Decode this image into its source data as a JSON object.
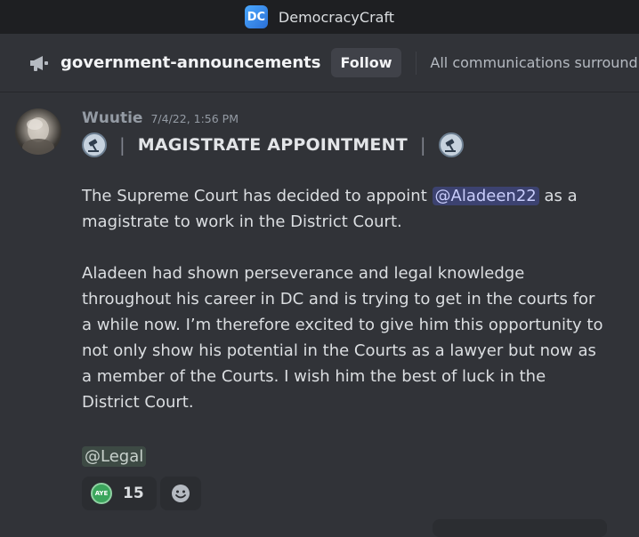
{
  "app": {
    "title": "DemocracyCraft",
    "logo_text": "DC",
    "logo_icon": "democracycraft-logo-icon"
  },
  "channel": {
    "icon": "megaphone-icon",
    "name": "government-announcements",
    "follow_label": "Follow",
    "topic": "All communications surround..."
  },
  "message": {
    "author": "Wuutie",
    "timestamp": "7/4/22, 1:56 PM",
    "heading_separator": "|",
    "heading": "MAGISTRATE APPOINTMENT",
    "heading_icon": "court-gavel-emoji-icon",
    "paragraph1_pre": "The Supreme Court has decided to appoint ",
    "mention_user": "@Aladeen22",
    "paragraph1_post": " as a magistrate to work in the District Court.",
    "paragraph2": "Aladeen had shown perseverance and legal knowledge throughout his career in DC and is trying to get in the courts for a while now. I’m therefore excited to give him this opportunity to not only show his potential in the Courts as a lawyer but now as a member of the Courts. I wish him the best of luck in the District Court.",
    "role_mention": "@Legal"
  },
  "reactions": [
    {
      "emoji_text": "AYE",
      "count": "15",
      "icon": "aye-emoji-icon"
    }
  ],
  "add_reaction_icon": "add-reaction-smiley-icon",
  "colors": {
    "background": "#313338",
    "titlebar": "#1e1f22",
    "mention_bg": "#3c4270",
    "aye_green": "#3ba55c"
  }
}
